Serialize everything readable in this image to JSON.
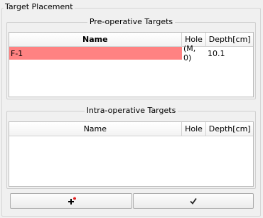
{
  "title": "Target Placement",
  "pre_op": {
    "title": "Pre-operative Targets",
    "columns": [
      "Name",
      "Hole",
      "Depth[cm]"
    ],
    "rows": [
      {
        "name": "F-1",
        "hole": "(M, 0)",
        "depth": "10.1"
      }
    ]
  },
  "intra_op": {
    "title": "Intra-operative Targets",
    "columns": [
      "Name",
      "Hole",
      "Depth[cm]"
    ],
    "rows": []
  },
  "buttons": {
    "add": {
      "icon": "add-target-icon"
    },
    "confirm": {
      "icon": "checkmark-icon"
    }
  },
  "colors": {
    "selected_row": "#ff8282",
    "plus": "#000000",
    "star": "#e02020"
  }
}
